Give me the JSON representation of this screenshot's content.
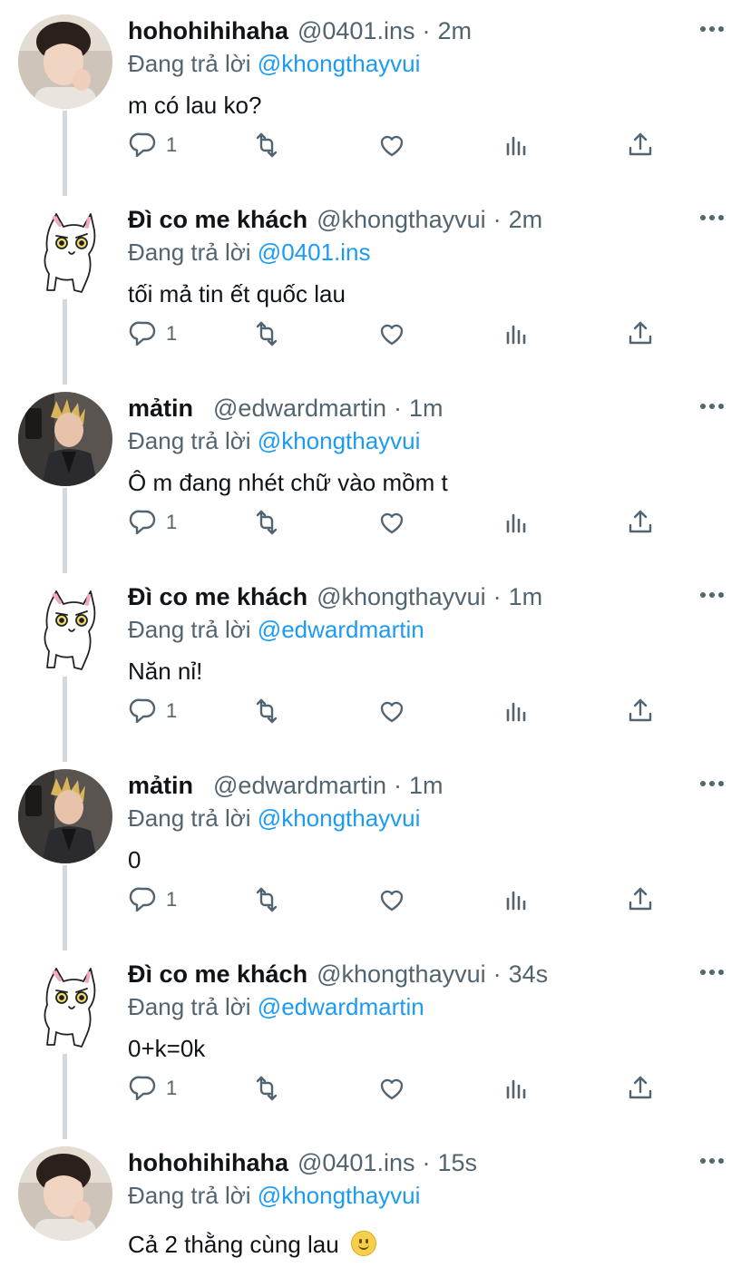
{
  "tweets": [
    {
      "name": "hohohihihaha",
      "handle": "@0401.ins",
      "time": "2m",
      "replying_prefix": "Đang trả lời",
      "replying_to": "@khongthayvui",
      "text": "m có lau ko?",
      "reply_count": "1",
      "avatar_icon": "user-photo-icon"
    },
    {
      "name": "Đì co me khách",
      "handle": "@khongthayvui",
      "time": "2m",
      "replying_prefix": "Đang trả lời",
      "replying_to": "@0401.ins",
      "text": "tối mả tin ết quốc lau",
      "reply_count": "1",
      "avatar_icon": "cat-drawing-icon"
    },
    {
      "name": "mảtin",
      "handle": "@edwardmartin",
      "time": "1m",
      "replying_prefix": "Đang trả lời",
      "replying_to": "@khongthayvui",
      "text": "Ô m đang nhét chữ vào mồm t",
      "reply_count": "1",
      "avatar_icon": "user-photo-icon"
    },
    {
      "name": "Đì co me khách",
      "handle": "@khongthayvui",
      "time": "1m",
      "replying_prefix": "Đang trả lời",
      "replying_to": "@edwardmartin",
      "text": "Năn nỉ!",
      "reply_count": "1",
      "avatar_icon": "cat-drawing-icon"
    },
    {
      "name": "mảtin",
      "handle": "@edwardmartin",
      "time": "1m",
      "replying_prefix": "Đang trả lời",
      "replying_to": "@khongthayvui",
      "text": "0",
      "reply_count": "1",
      "avatar_icon": "user-photo-icon"
    },
    {
      "name": "Đì co me khách",
      "handle": "@khongthayvui",
      "time": "34s",
      "replying_prefix": "Đang trả lời",
      "replying_to": "@edwardmartin",
      "text": "0+k=0k",
      "reply_count": "1",
      "avatar_icon": "cat-drawing-icon"
    },
    {
      "name": "hohohihihaha",
      "handle": "@0401.ins",
      "time": "15s",
      "replying_prefix": "Đang trả lời",
      "replying_to": "@khongthayvui",
      "text": "Cả 2 thằng cùng lau",
      "reply_count": "",
      "avatar_icon": "user-photo-icon",
      "trailing_emoji": "slightly-smiling-face-icon"
    }
  ],
  "action_icons": [
    "reply-icon",
    "retweet-icon",
    "like-icon",
    "views-icon",
    "share-icon"
  ],
  "colors": {
    "link": "#1d9bf0",
    "secondary_text": "#536471",
    "thread_line": "#cfd9de"
  }
}
